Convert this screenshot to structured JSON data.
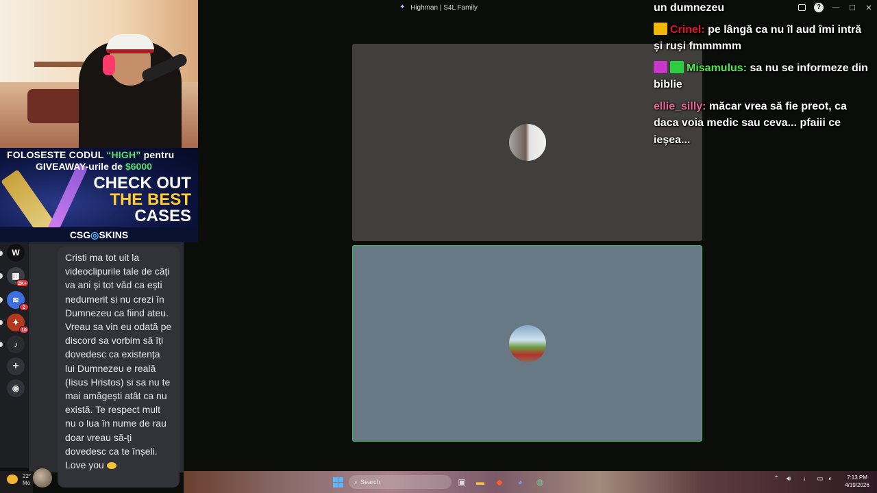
{
  "window": {
    "title": "Highman | S4L Family"
  },
  "sponsor": {
    "line1_prefix": "FOLOSESTE CODUL ",
    "code": "“HIGH”",
    "line1_suffix": " pentru",
    "line2_prefix": "GIVEAWAY-urile de ",
    "amount": "$6000",
    "cta1": "CHECK OUT",
    "cta2": "THE BEST",
    "cta3": "CASES",
    "brand_left": "CSG",
    "brand_mid": "◎",
    "brand_right": "SKINS"
  },
  "rail": {
    "items": [
      {
        "icon": "wattpad-icon",
        "glyph": "W",
        "badge": ""
      },
      {
        "icon": "server-folder-icon",
        "glyph": "▦",
        "badge": "2K+"
      },
      {
        "icon": "server-blue-icon",
        "glyph": "≋",
        "badge": "2"
      },
      {
        "icon": "server-red-icon",
        "glyph": "✦",
        "badge": "10"
      },
      {
        "icon": "server-music-icon",
        "glyph": "♪",
        "badge": ""
      },
      {
        "icon": "add-server-icon",
        "glyph": "+",
        "badge": ""
      },
      {
        "icon": "explore-icon",
        "glyph": "◉",
        "badge": ""
      }
    ]
  },
  "message": {
    "text": "Cristi ma tot uit la videoclipurile tale de câți va ani și tot văd ca ești nedumerit si nu crezi în Dumnezeu ca fiind ateu. Vreau sa vin eu odată pe discord sa vorbim să îți dovedesc ca existența lui Dumnezeu e reală (Iisus Hristos) si sa nu te mai amăgești atât ca nu există. Te respect mult nu o lua în nume de rau doar vreau să-ți dovedesc ca te înșeli. Love you",
    "emoji": "heart-hands-emoji"
  },
  "chat": {
    "messages": [
      {
        "user": "",
        "user_color": "#ffffff",
        "text": "un dumnezeu",
        "icons": []
      },
      {
        "user": "Crinel:",
        "user_color": "#e8102c",
        "text": " pe lângă ca nu îl aud îmi intră și ruși fmmmmm",
        "icons": [
          "crown-badge-icon"
        ]
      },
      {
        "user": "Misamulus:",
        "user_color": "#4ce84c",
        "text": " sa nu se informeze din biblie",
        "icons": [
          "moderator-badge-icon",
          "gift-badge-icon"
        ]
      },
      {
        "user": "ellie_silly:",
        "user_color": "#e86497",
        "text": " măcar vrea să fie preot, ca daca voia medic sau ceva... pfaiii ce ieșea...",
        "icons": []
      }
    ],
    "badge_colors": {
      "crown": "#f2b705",
      "moderator": "#c838c8",
      "gift": "#2ecc40"
    }
  },
  "taskbar": {
    "weather_temp": "22°",
    "weather_text": "Mo",
    "search_placeholder": "Search",
    "time": "7:13 PM",
    "date": "4/19/2026"
  },
  "colors": {
    "speaking_outline": "#2ec15a",
    "tile_top": "#403f3c",
    "tile_bottom": "#687985"
  }
}
